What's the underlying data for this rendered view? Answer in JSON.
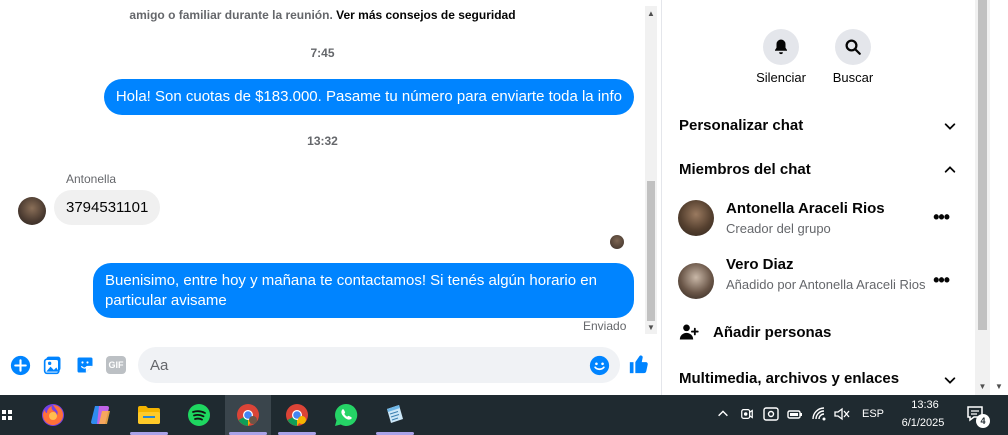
{
  "chat": {
    "security_tip": "amigo o familiar durante la reunión.",
    "security_link": "Ver más consejos de seguridad",
    "time1": "7:45",
    "msg_out_1": "Hola! Son cuotas de $183.000. Pasame tu número para enviarte toda la info",
    "time2": "13:32",
    "sender_name": "Antonella",
    "msg_in_1": "3794531101",
    "msg_out_2": "Buenisimo, entre hoy y mañana te contactamos! Si tenés algún horario en particular avisame",
    "sent_status": "Enviado"
  },
  "composer": {
    "placeholder": "Aa",
    "gif_label": "GIF"
  },
  "side_panel": {
    "mute_label": "Silenciar",
    "search_label": "Buscar",
    "customize_chat": "Personalizar chat",
    "chat_members": "Miembros del chat",
    "members": [
      {
        "name": "Antonella Araceli Rios",
        "role": "Creador del grupo"
      },
      {
        "name": "Vero Diaz",
        "role": "Añadido por Antonella Araceli Rios"
      }
    ],
    "add_people": "Añadir personas",
    "media_files": "Multimedia, archivos y enlaces",
    "more_glyph": "•••"
  },
  "taskbar": {
    "language": "ESP",
    "time": "13:36",
    "date": "6/1/2025",
    "notification_count": "4",
    "apps": [
      "firefox-icon",
      "copilot-icon",
      "file-explorer-icon",
      "spotify-icon",
      "chrome-icon",
      "chrome-profile-icon",
      "whatsapp-icon",
      "notepad-icon"
    ]
  },
  "colors": {
    "messenger_blue": "#0084ff",
    "taskbar_bg": "#1f2a30"
  }
}
